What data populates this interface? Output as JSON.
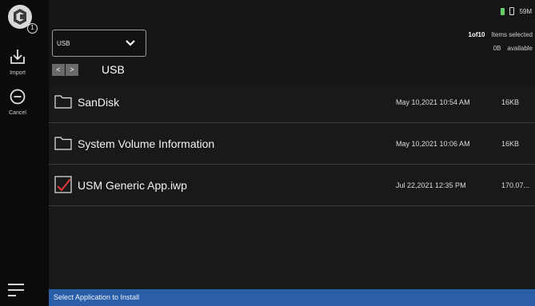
{
  "toolbar": {
    "logo_badge": "1",
    "import_label": "Import",
    "cancel_label": "Cancel"
  },
  "status": {
    "memory": "59M"
  },
  "source": {
    "selected": "USB"
  },
  "selection": {
    "count": "1of10",
    "count_label": "Items selected",
    "free": "0B",
    "free_label": "available"
  },
  "nav": {
    "back": "<",
    "forward": ">",
    "path": "USB"
  },
  "files": [
    {
      "name": "SanDisk",
      "date": "May 10,2021 10:54 AM",
      "size": "16KB",
      "type": "folder",
      "checked": false
    },
    {
      "name": "System Volume Information",
      "date": "May 10,2021 10:06 AM",
      "size": "16KB",
      "type": "folder",
      "checked": false
    },
    {
      "name": "USM Generic App.iwp",
      "date": "Jul 22,2021 12:35 PM",
      "size": "170.07...",
      "type": "file",
      "checked": true
    }
  ],
  "footer": {
    "message": "Select Application to Install"
  },
  "colors": {
    "statusbar": "#2b5ea9",
    "check": "#e03a3a",
    "battery": "#64c864"
  }
}
